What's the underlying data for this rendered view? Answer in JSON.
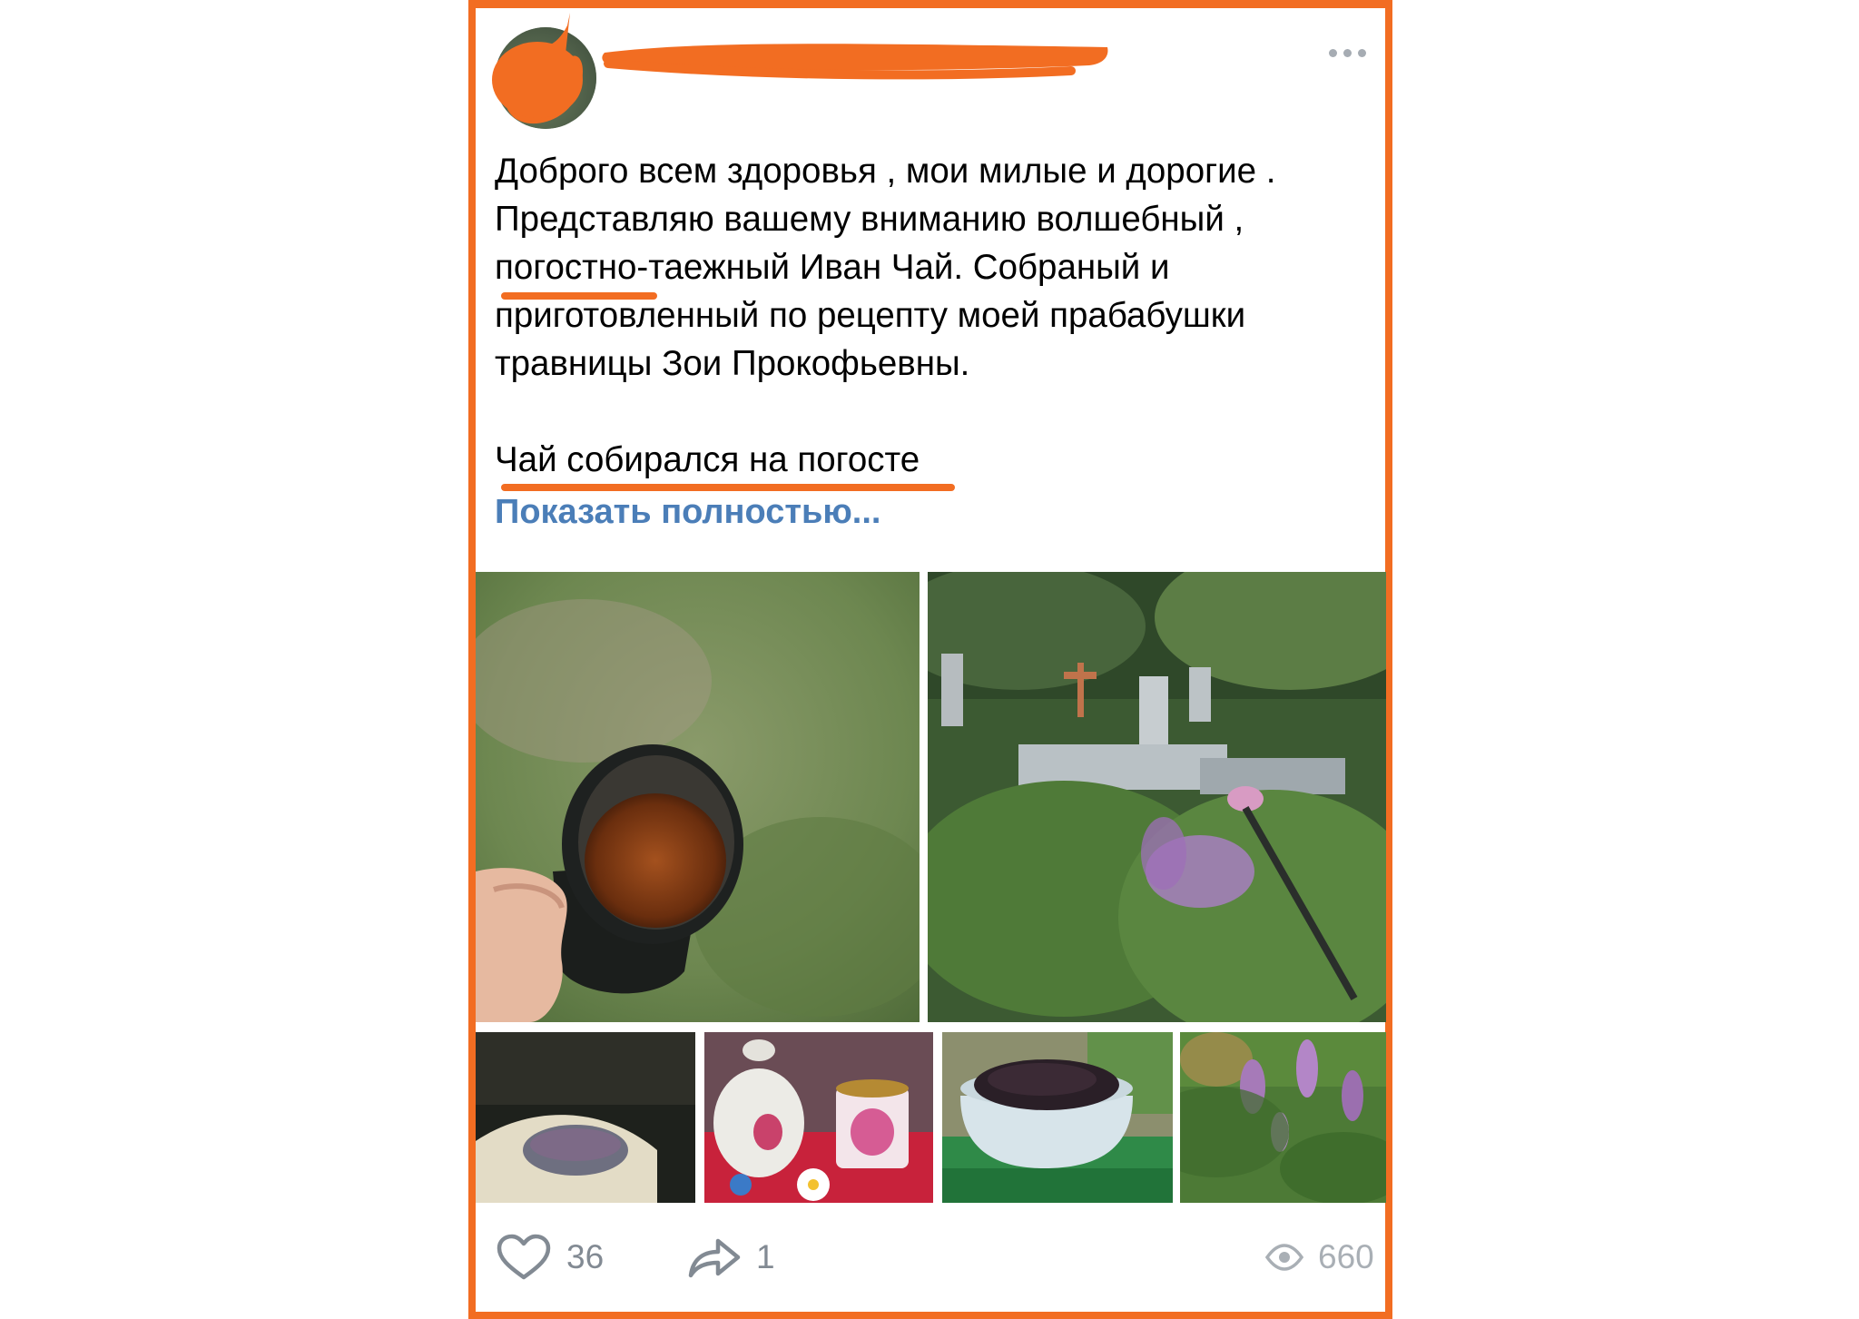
{
  "post": {
    "text_lines": [
      "Доброго всем здоровья , мои милые и дорогие .",
      "Представляю вашему вниманию волшебный ,",
      "погостно-таежный Иван Чай. Собраный и",
      "приготовленный по рецепту моей прабабушки",
      "травницы Зои Прокофьевны."
    ],
    "text_line_2": "Чай собирался на погосте",
    "show_more": "Показать полностью..."
  },
  "actions": {
    "likes": "36",
    "shares": "1",
    "views": "660"
  },
  "colors": {
    "accent_orange": "#f26d22",
    "link_blue": "#4b7eb8",
    "muted_gray": "#828a93"
  },
  "photos": [
    "tea-cup-photo",
    "cemetery-photo",
    "night-bowl-photo",
    "teapot-photo",
    "dried-tea-bowl-photo",
    "fireweed-photo"
  ]
}
